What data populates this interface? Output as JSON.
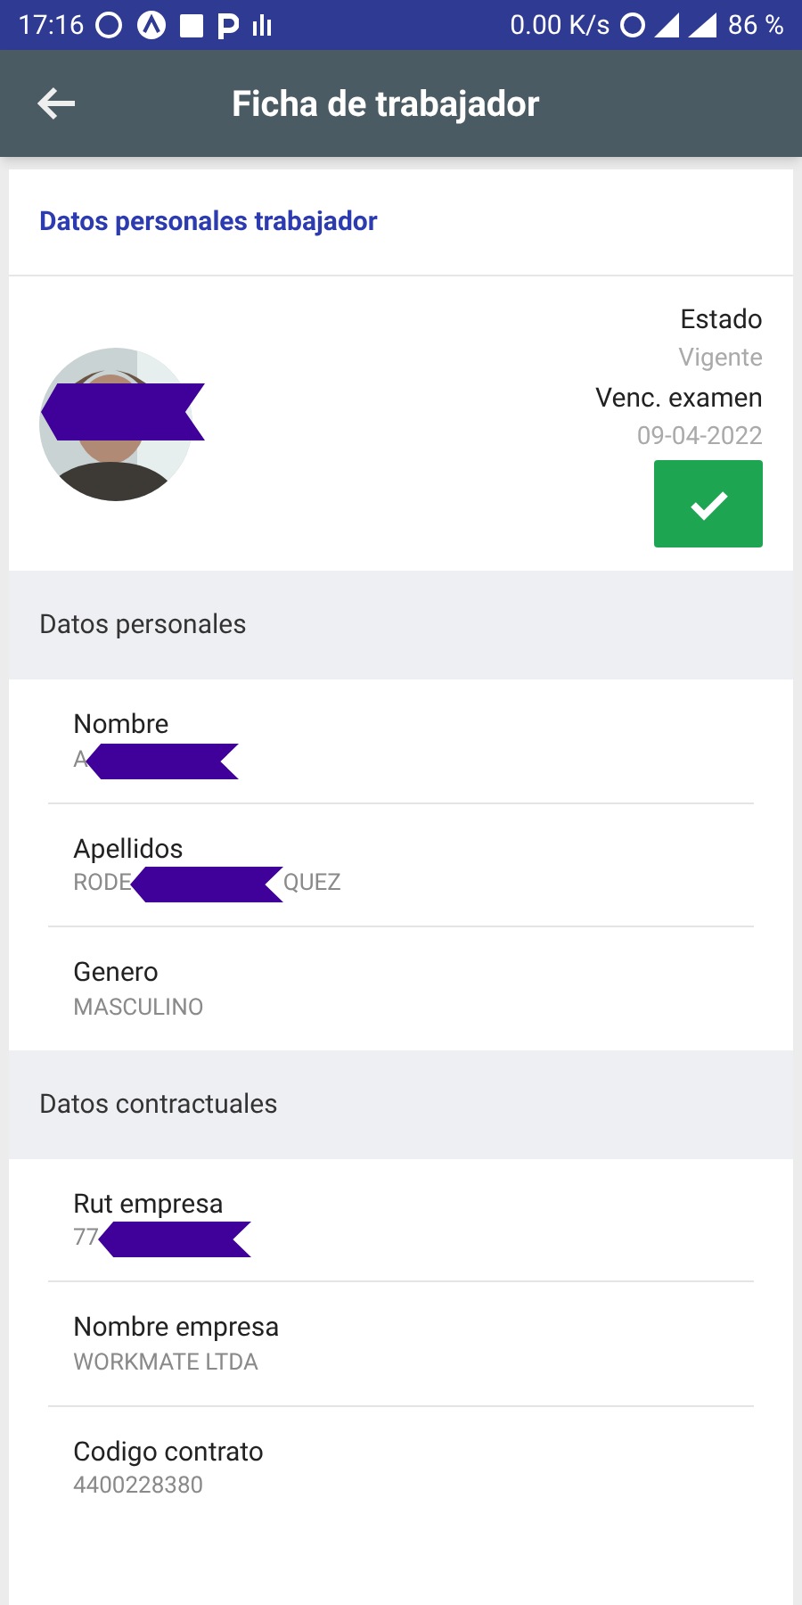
{
  "status_bar": {
    "time": "17:16",
    "speed": "0.00 K/s",
    "battery": "86 %"
  },
  "app_bar": {
    "title": "Ficha de trabajador"
  },
  "card": {
    "title": "Datos personales trabajador"
  },
  "profile": {
    "avatar": {
      "redacted": true
    },
    "status_label": "Estado",
    "status_value": "Vigente",
    "exam_label": "Venc. examen",
    "exam_value": "09-04-2022",
    "valid": true
  },
  "sections": [
    {
      "title": "Datos personales",
      "fields": [
        {
          "label": "Nombre",
          "value": "A",
          "redacted": true
        },
        {
          "label": "Apellidos",
          "value": "RODE",
          "redacted": true,
          "value_after": "QUEZ"
        },
        {
          "label": "Genero",
          "value": "MASCULINO",
          "redacted": false
        }
      ]
    },
    {
      "title": "Datos contractuales",
      "fields": [
        {
          "label": "Rut empresa",
          "value": "77",
          "redacted": true
        },
        {
          "label": "Nombre empresa",
          "value": "WORKMATE LTDA",
          "redacted": false
        },
        {
          "label": "Codigo contrato",
          "value": "4400228380",
          "redacted": false
        }
      ]
    }
  ]
}
